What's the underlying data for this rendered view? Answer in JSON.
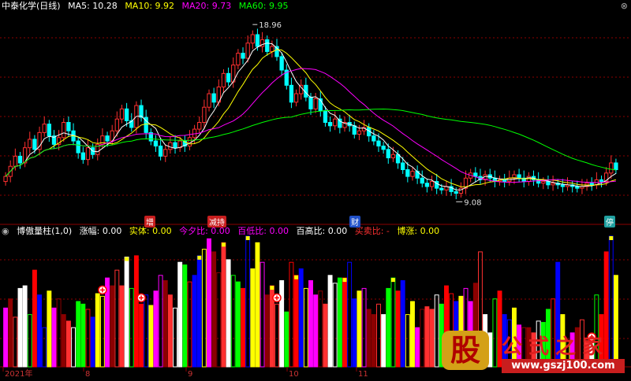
{
  "main_header": {
    "title": "中泰化学(日线)",
    "ma": [
      {
        "label": "MA5: 10.28",
        "color": "#ffffff"
      },
      {
        "label": "MA10: 9.92",
        "color": "#ffff00"
      },
      {
        "label": "MA20: 9.73",
        "color": "#ff00ff"
      },
      {
        "label": "MA60: 9.95",
        "color": "#00ff00"
      }
    ],
    "close_icon": "circle-x-icon"
  },
  "sub_header": {
    "title": "博傲量柱(1,0)",
    "items": [
      {
        "label": "涨幅: 0.00",
        "color": "#ffffff"
      },
      {
        "label": "实体: 0.00",
        "color": "#ffff00"
      },
      {
        "label": "今夕比: 0.00",
        "color": "#ff00ff"
      },
      {
        "label": "百低比: 0.00",
        "color": "#ff00ff"
      },
      {
        "label": "百高比: 0.00",
        "color": "#ffffff"
      },
      {
        "label": "买卖比: -",
        "color": "#ff3030"
      },
      {
        "label": "博涨: 0.00",
        "color": "#ffff00"
      }
    ]
  },
  "event_tags": [
    {
      "label": "增",
      "color": "#c81e1e"
    },
    {
      "label": "减持",
      "color": "#c81e1e"
    },
    {
      "label": "财",
      "color": "#2050c8"
    },
    {
      "label": "停",
      "color": "#20a0a0"
    }
  ],
  "x_axis_labels": [
    "2021年",
    "8",
    "9",
    "10",
    "11"
  ],
  "watermark": {
    "brand": "公式之家",
    "url": "www.gszj100.com",
    "logo_char": "股"
  },
  "chart_data": [
    {
      "type": "candlestick",
      "title": "中泰化学(日线)",
      "high_annotation": "18.96",
      "low_annotation": "9.08",
      "ylim": [
        7.5,
        20
      ],
      "closes": [
        10.2,
        10.8,
        11.4,
        11.0,
        11.9,
        12.4,
        11.8,
        12.8,
        13.3,
        12.6,
        12.1,
        12.5,
        13.4,
        12.9,
        12.3,
        11.6,
        11.2,
        11.9,
        11.5,
        12.1,
        12.6,
        12.3,
        12.9,
        13.6,
        14.2,
        13.5,
        13.1,
        14.4,
        13.7,
        12.8,
        12.3,
        12.0,
        11.4,
        11.8,
        12.2,
        11.9,
        12.3,
        12.0,
        12.5,
        13.0,
        13.4,
        14.3,
        15.1,
        14.6,
        15.5,
        16.3,
        15.8,
        16.8,
        17.5,
        17.2,
        18.1,
        18.6,
        17.9,
        18.3,
        17.6,
        17.9,
        17.3,
        16.5,
        15.6,
        14.6,
        15.1,
        15.6,
        14.9,
        14.2,
        14.8,
        14.1,
        13.4,
        13.2,
        13.6,
        13.1,
        13.4,
        13.2,
        12.7,
        12.9,
        13.1,
        12.6,
        12.3,
        12.0,
        11.8,
        11.3,
        11.5,
        11.0,
        10.6,
        10.2,
        10.5,
        10.1,
        9.8,
        9.6,
        9.9,
        9.5,
        9.4,
        9.6,
        9.3,
        9.2,
        9.5,
        10.1,
        10.4,
        10.2,
        10.0,
        10.3,
        10.1,
        9.9,
        10.0,
        9.9,
        10.1,
        10.3,
        10.1,
        9.9,
        10.2,
        10.0,
        9.8,
        9.9,
        9.7,
        9.8,
        9.7,
        9.6,
        9.7,
        9.6,
        9.5,
        9.6,
        9.8,
        9.7,
        10.0,
        9.9,
        10.4,
        11.0,
        10.6
      ],
      "ma_series": [
        {
          "name": "MA5",
          "window": 5
        },
        {
          "name": "MA10",
          "window": 10
        },
        {
          "name": "MA20",
          "window": 20
        },
        {
          "name": "MA60",
          "window": 60
        }
      ]
    },
    {
      "type": "bar",
      "title": "博傲量柱(1,0)",
      "values": [
        45,
        52,
        38,
        60,
        62,
        40,
        74,
        55,
        30,
        58,
        45,
        52,
        40,
        35,
        30,
        50,
        48,
        44,
        38,
        56,
        54,
        68,
        62,
        74,
        62,
        84,
        60,
        85,
        48,
        55,
        47,
        58,
        70,
        66,
        55,
        45,
        80,
        78,
        65,
        70,
        85,
        90,
        98,
        88,
        72,
        95,
        82,
        70,
        65,
        60,
        100,
        75,
        95,
        80,
        55,
        62,
        48,
        66,
        42,
        80,
        70,
        75,
        60,
        66,
        55,
        58,
        48,
        70,
        64,
        68,
        68,
        80,
        52,
        58,
        60,
        44,
        40,
        48,
        40,
        60,
        68,
        58,
        66,
        40,
        50,
        30,
        44,
        46,
        44,
        55,
        48,
        62,
        56,
        50,
        54,
        60,
        50,
        64,
        88,
        40,
        26,
        52,
        58,
        40,
        36,
        45,
        32,
        30,
        30,
        26,
        35,
        34,
        44,
        52,
        80,
        40,
        20,
        26,
        30,
        36,
        20,
        18,
        55,
        40,
        88,
        100,
        70
      ],
      "ylim": [
        0,
        100
      ]
    }
  ]
}
